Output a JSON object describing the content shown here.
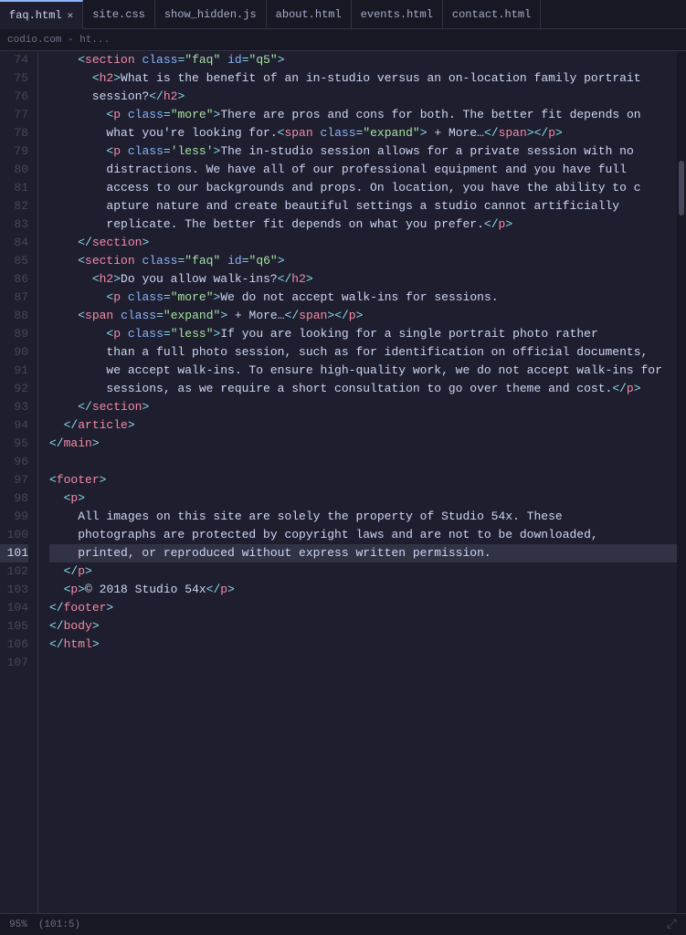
{
  "tabs": [
    {
      "label": "faq.html",
      "active": true,
      "has_close": true
    },
    {
      "label": "site.css",
      "active": false,
      "has_close": false
    },
    {
      "label": "show_hidden.js",
      "active": false,
      "has_close": false
    },
    {
      "label": "about.html",
      "active": false,
      "has_close": false
    },
    {
      "label": "events.html",
      "active": false,
      "has_close": false
    },
    {
      "label": "contact.html",
      "active": false,
      "has_close": false
    }
  ],
  "breadcrumb": "codio.com - ht...",
  "status": {
    "zoom": "95%",
    "position": "(101:5)"
  },
  "active_line": 101,
  "lines": [
    {
      "num": 74,
      "content": "    <section class=\"faq\" id=\"q5\">"
    },
    {
      "num": 75,
      "content": "      <h2>What is the benefit of an in-studio versus an on-location family portrait"
    },
    {
      "num": 76,
      "content": "      session?</h2>"
    },
    {
      "num": 77,
      "content": "        <p class=\"more\">There are pros and cons for both. The better fit depends on"
    },
    {
      "num": 78,
      "content": "        what you're looking for.<span class=\"expand\"> + More…</span></p>"
    },
    {
      "num": 79,
      "content": "        <p class='less'>The in-studio session allows for a private session with no"
    },
    {
      "num": 80,
      "content": "        distractions. We have all of our professional equipment and you have full"
    },
    {
      "num": 81,
      "content": "        access to our backgrounds and props. On location, you have the ability to c"
    },
    {
      "num": 82,
      "content": "        apture nature and create beautiful settings a studio cannot artificially"
    },
    {
      "num": 83,
      "content": "        replicate. The better fit depends on what you prefer.</p>"
    },
    {
      "num": 84,
      "content": "    </section>"
    },
    {
      "num": 85,
      "content": "    <section class=\"faq\" id=\"q6\">"
    },
    {
      "num": 86,
      "content": "      <h2>Do you allow walk-ins?</h2>"
    },
    {
      "num": 87,
      "content": "        <p class=\"more\">We do not accept walk-ins for sessions."
    },
    {
      "num": 88,
      "content": "    <span class=\"expand\"> + More…</span></p>"
    },
    {
      "num": 89,
      "content": "        <p class=\"less\">If you are looking for a single portrait photo rather"
    },
    {
      "num": 90,
      "content": "        than a full photo session, such as for identification on official documents,"
    },
    {
      "num": 91,
      "content": "        we accept walk-ins. To ensure high-quality work, we do not accept walk-ins for"
    },
    {
      "num": 92,
      "content": "        sessions, as we require a short consultation to go over theme and cost.</p>"
    },
    {
      "num": 93,
      "content": "    </section>"
    },
    {
      "num": 94,
      "content": "  </article>"
    },
    {
      "num": 95,
      "content": "</main>"
    },
    {
      "num": 96,
      "content": ""
    },
    {
      "num": 97,
      "content": "<footer>"
    },
    {
      "num": 98,
      "content": "  <p>"
    },
    {
      "num": 99,
      "content": "    All images on this site are solely the property of Studio 54x. These"
    },
    {
      "num": 100,
      "content": "    photographs are protected by copyright laws and are not to be downloaded,"
    },
    {
      "num": 101,
      "content": "    printed, or reproduced without express written permission."
    },
    {
      "num": 102,
      "content": "  </p>"
    },
    {
      "num": 103,
      "content": "  <p>© 2018 Studio 54x</p>"
    },
    {
      "num": 104,
      "content": "</footer>"
    },
    {
      "num": 105,
      "content": "</body>"
    },
    {
      "num": 106,
      "content": "</html>"
    },
    {
      "num": 107,
      "content": ""
    }
  ]
}
